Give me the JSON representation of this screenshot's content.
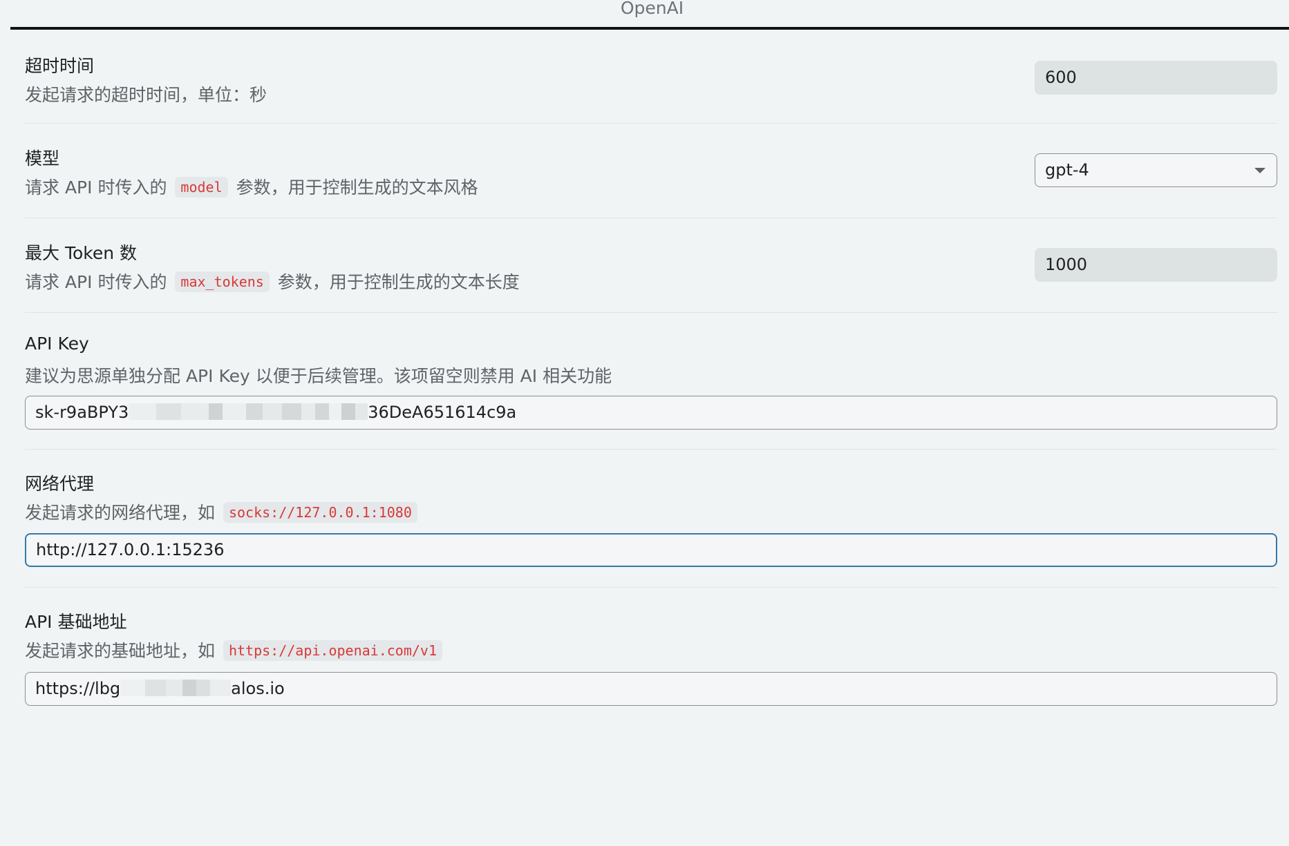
{
  "tab": {
    "title": "OpenAI"
  },
  "timeout": {
    "label": "超时时间",
    "description": "发起请求的超时时间，单位：秒",
    "value": "600"
  },
  "model": {
    "label": "模型",
    "description_prefix": "请求 API 时传入的",
    "code": "model",
    "description_suffix": "参数，用于控制生成的文本风格",
    "selected": "gpt-4"
  },
  "max_tokens": {
    "label": "最大 Token 数",
    "description_prefix": "请求 API 时传入的",
    "code": "max_tokens",
    "description_suffix": "参数，用于控制生成的文本长度",
    "value": "1000"
  },
  "api_key": {
    "label": "API Key",
    "description": "建议为思源单独分配 API Key 以便于后续管理。该项留空则禁用 AI 相关功能",
    "value_start": "sk-r9aBPY3",
    "value_end": "36DeA651614c9a"
  },
  "proxy": {
    "label": "网络代理",
    "description_prefix": "发起请求的网络代理，如",
    "code": "socks://127.0.0.1:1080",
    "value": "http://127.0.0.1:15236"
  },
  "base_url": {
    "label": "API 基础地址",
    "description_prefix": "发起请求的基础地址，如",
    "code": "https://api.openai.com/v1",
    "value_start": "https://lbg",
    "value_end": "alos.io"
  },
  "colors": {
    "background": "#f1f4f5",
    "code_text": "#d93838",
    "focus_border": "#3578a5"
  }
}
